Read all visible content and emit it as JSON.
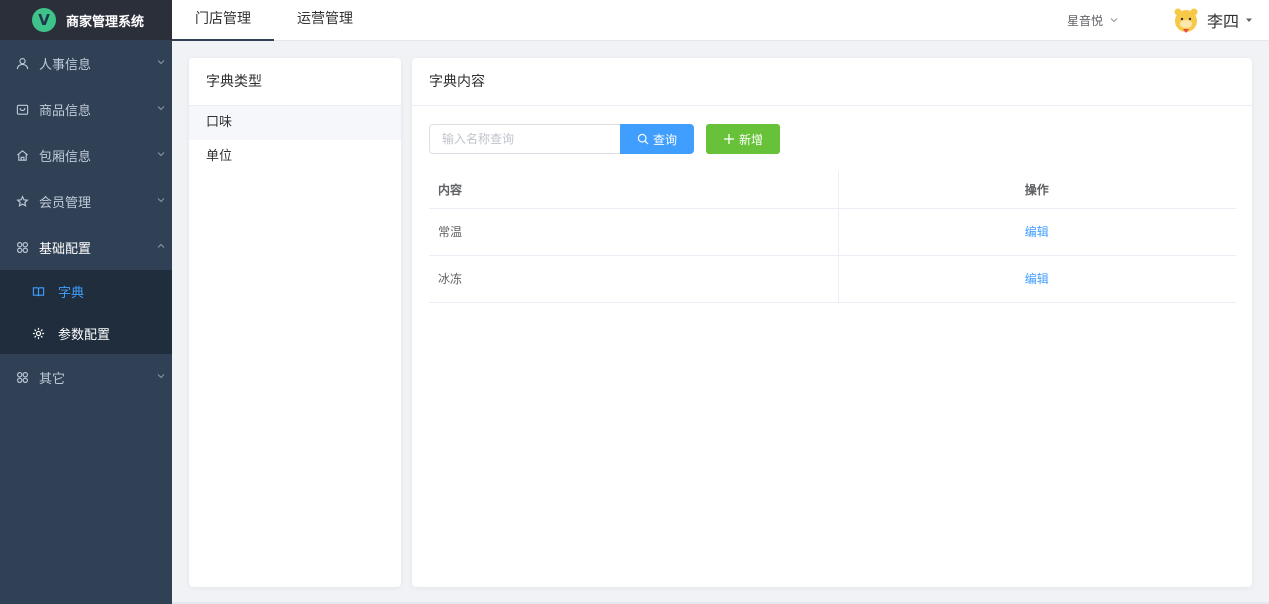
{
  "app": {
    "logo_letter": "V",
    "title": "商家管理系统"
  },
  "topnav": {
    "items": [
      "门店管理",
      "运营管理"
    ]
  },
  "header": {
    "store": "星音悦",
    "user": "李四"
  },
  "sidebar": {
    "items": [
      {
        "label": "人事信息",
        "icon": "user-icon"
      },
      {
        "label": "商品信息",
        "icon": "goods-icon"
      },
      {
        "label": "包厢信息",
        "icon": "home-icon"
      },
      {
        "label": "会员管理",
        "icon": "star-icon"
      },
      {
        "label": "基础配置",
        "icon": "grid-icon"
      },
      {
        "label": "其它",
        "icon": "grid-icon"
      }
    ],
    "sub_items": [
      {
        "label": "字典",
        "icon": "book-icon"
      },
      {
        "label": "参数配置",
        "icon": "gear-icon"
      }
    ]
  },
  "dict_type": {
    "title": "字典类型",
    "items": [
      "口味",
      "单位"
    ]
  },
  "dict_content": {
    "title": "字典内容",
    "search_placeholder": "输入名称查询",
    "query_label": "查询",
    "add_label": "新增",
    "columns": [
      "内容",
      "操作"
    ],
    "rows": [
      {
        "content": "常温",
        "action": "编辑"
      },
      {
        "content": "冰冻",
        "action": "编辑"
      }
    ]
  },
  "colors": {
    "sidebar_bg": "#304156",
    "primary": "#409eff",
    "success": "#67c23a"
  }
}
